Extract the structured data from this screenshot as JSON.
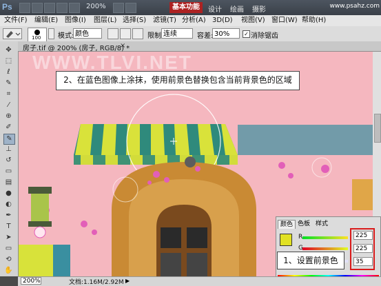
{
  "titlebar": {
    "app_logo": "Ps",
    "zoom": "200%",
    "workspace": "基本功能",
    "tabs": [
      "设计",
      "绘画",
      "摄影"
    ],
    "site_watermark": "www.psahz.com"
  },
  "menu": [
    "文件(F)",
    "编辑(E)",
    "图像(I)",
    "图层(L)",
    "选择(S)",
    "滤镜(T)",
    "分析(A)",
    "3D(D)",
    "视图(V)",
    "窗口(W)",
    "帮助(H)"
  ],
  "options": {
    "brush_size": "100",
    "mode_label": "模式:",
    "mode_value": "颜色",
    "limit_label": "限制:",
    "limit_value": "连续",
    "tolerance_label": "容差:",
    "tolerance_value": "30%",
    "antialias_label": "消除锯齿",
    "antialias_checked": true
  },
  "document": {
    "tab_label": "房子.tif @ 200% (房子, RGB/8) *",
    "canvas_watermark": "WWW.TLVI.NET"
  },
  "callouts": {
    "step2": "2、在蓝色图像上涂抹，使用前景色替换包含当前背景色的区域",
    "step1": "1、设置前景色"
  },
  "status": {
    "zoom": "200%",
    "doc_info": "文档:1.16M/2.92M"
  },
  "color_panel": {
    "tabs": [
      "颜色",
      "色板",
      "样式"
    ],
    "channels": [
      {
        "label": "R",
        "value": "225"
      },
      {
        "label": "G",
        "value": "225"
      },
      {
        "label": "B",
        "value": "35"
      }
    ],
    "foreground_color": "#e1e123",
    "background_color": "#3a6fb0"
  },
  "colors": {
    "canvas_pink": "#f5b7bf",
    "awning_yellow": "#d9e23a",
    "awning_teal": "#2f8a7c",
    "highlight_red": "#d91a1a"
  }
}
